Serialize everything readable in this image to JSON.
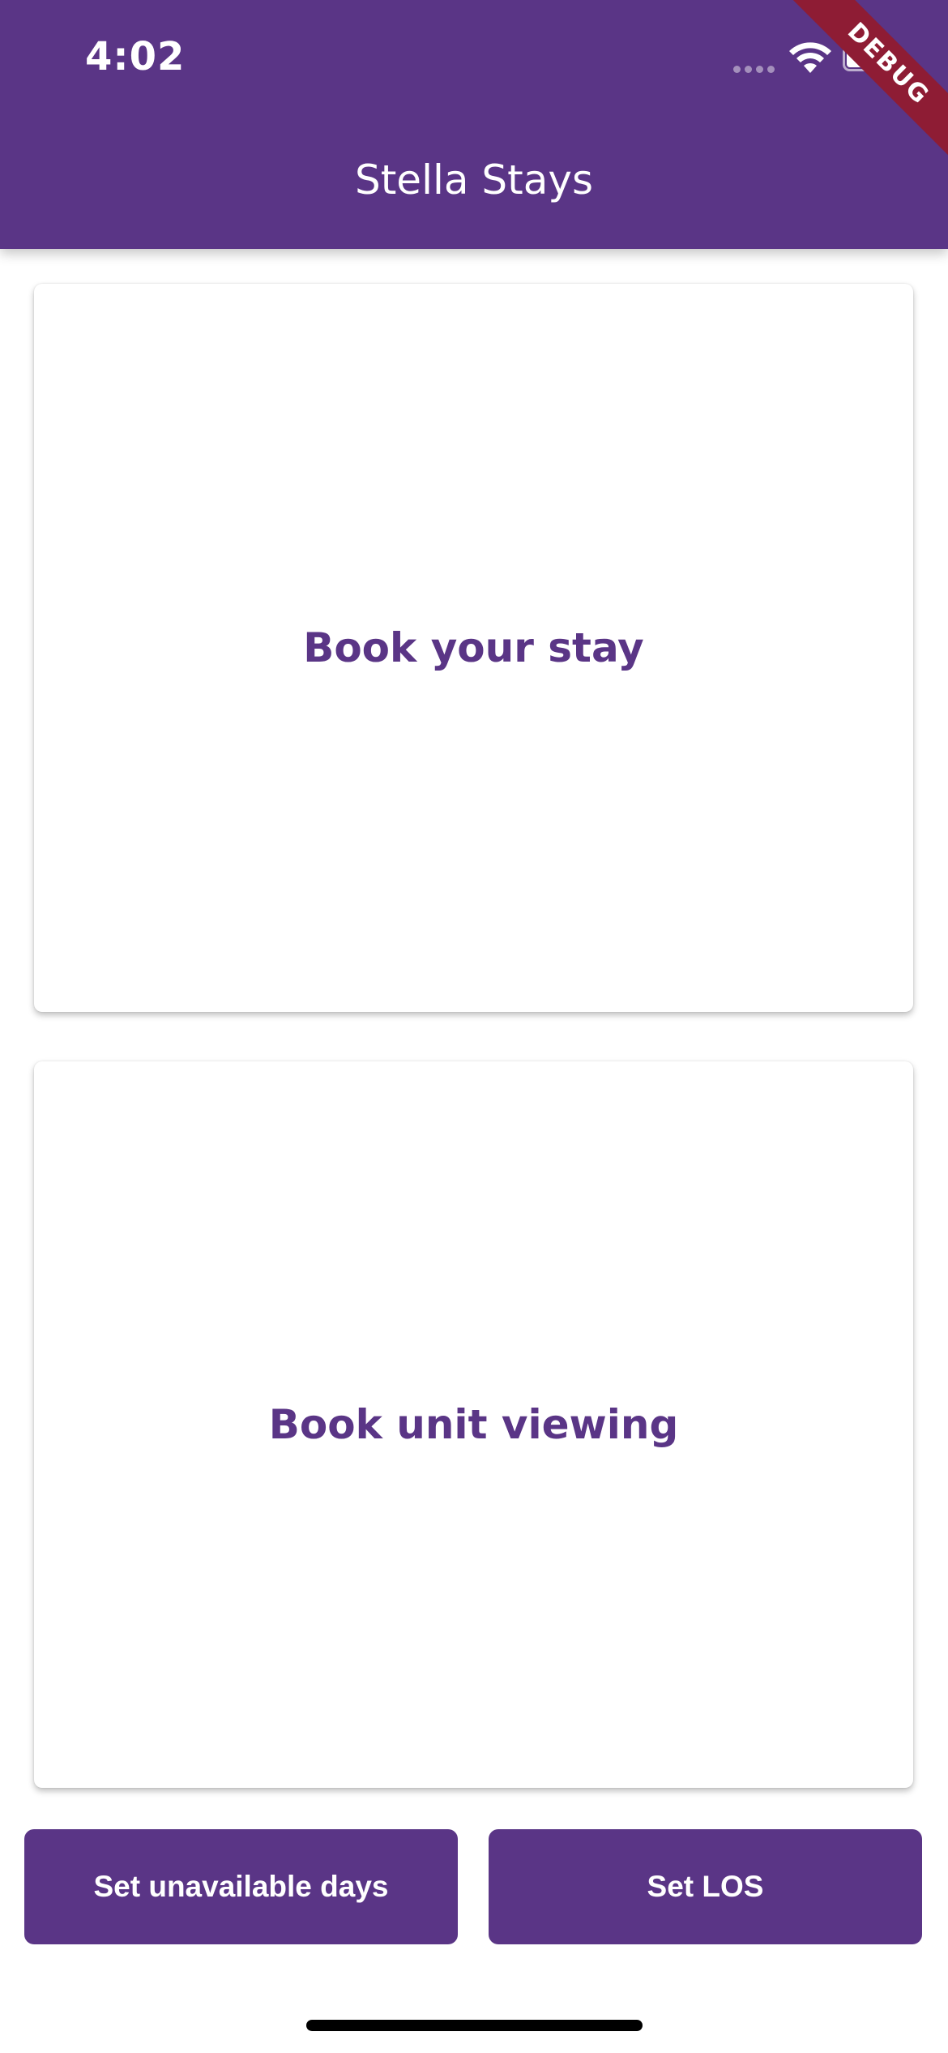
{
  "status_bar": {
    "time": "4:02",
    "icons": [
      "cellular-signal-icon",
      "wifi-icon",
      "battery-icon"
    ]
  },
  "debug_banner": {
    "label": "DEBUG",
    "color": "#8E1C34"
  },
  "app_bar": {
    "title": "Stella Stays",
    "color": "#5A3586"
  },
  "main": {
    "cards": [
      {
        "label": "Book your stay"
      },
      {
        "label": "Book unit viewing"
      }
    ]
  },
  "actions": {
    "set_unavailable_days": "Set unavailable days",
    "set_los": "Set LOS"
  },
  "colors": {
    "primary": "#5A3586",
    "background": "#FFFFFF"
  }
}
